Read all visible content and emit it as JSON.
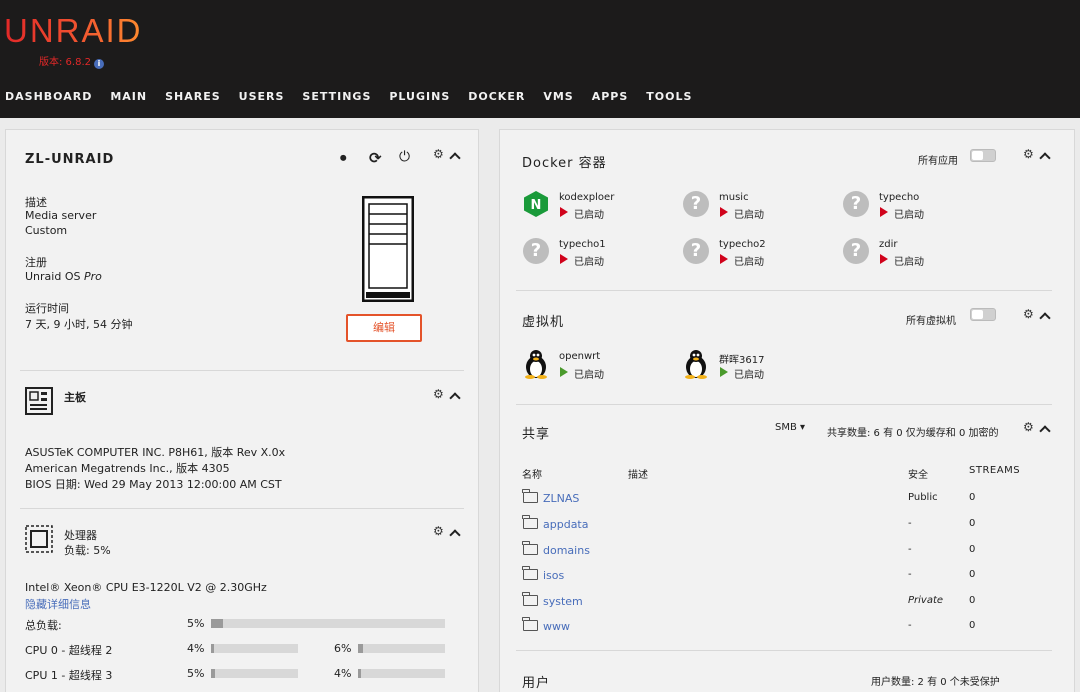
{
  "header": {
    "logo": "UNRAID",
    "version": "版本: 6.8.2",
    "nav": [
      "DASHBOARD",
      "MAIN",
      "SHARES",
      "USERS",
      "SETTINGS",
      "PLUGINS",
      "DOCKER",
      "VMS",
      "APPS",
      "TOOLS"
    ]
  },
  "server": {
    "name": "ZL-UNRAID",
    "desc_label": "描述",
    "desc_line1": "Media server",
    "desc_line2": "Custom",
    "reg_label": "注册",
    "reg_value": "Unraid OS ",
    "reg_tier": "Pro",
    "uptime_label": "运行时间",
    "uptime_value": "7 天, 9 小时, 54 分钟",
    "edit_label": "编辑"
  },
  "motherboard": {
    "title": "主板",
    "line1": "ASUSTeK COMPUTER INC. P8H61, 版本 Rev X.0x",
    "line2": "American Megatrends Inc., 版本 4305",
    "line3": "BIOS 日期: Wed 29 May 2013 12:00:00 AM CST"
  },
  "cpu": {
    "title": "处理器",
    "load_line": "负载: 5%",
    "model": "Intel® Xeon® CPU E3-1220L V2 @ 2.30GHz",
    "hide_link": "隐藏详细信息",
    "total_label": "总负载:",
    "total_value": "5%",
    "total_fraction": 0.05,
    "rows": [
      {
        "label": "CPU 0 - 超线程 2",
        "a": "4%",
        "a_frac": 0.04,
        "b": "6%",
        "b_frac": 0.06
      },
      {
        "label": "CPU 1 - 超线程 3",
        "a": "5%",
        "a_frac": 0.05,
        "b": "4%",
        "b_frac": 0.04
      }
    ]
  },
  "docker": {
    "title": "Docker 容器",
    "all_apps": "所有应用",
    "containers": [
      {
        "name": "kodexploer",
        "status": "已启动",
        "icon": "nginx-icon"
      },
      {
        "name": "music",
        "status": "已启动",
        "icon": "question-icon"
      },
      {
        "name": "typecho",
        "status": "已启动",
        "icon": "question-icon"
      },
      {
        "name": "typecho1",
        "status": "已启动",
        "icon": "question-icon"
      },
      {
        "name": "typecho2",
        "status": "已启动",
        "icon": "question-icon"
      },
      {
        "name": "zdir",
        "status": "已启动",
        "icon": "question-icon"
      }
    ]
  },
  "vms": {
    "title": "虚拟机",
    "all_vms": "所有虚拟机",
    "items": [
      {
        "name": "openwrt",
        "status": "已启动",
        "icon": "tux-icon"
      },
      {
        "name": "群晖3617",
        "status": "已启动",
        "icon": "tux-icon"
      }
    ]
  },
  "shares": {
    "title": "共享",
    "protocol": "SMB",
    "summary": "共享数量: 6 有 0 仅为缓存和 0 加密的",
    "col_name": "名称",
    "col_desc": "描述",
    "col_security": "安全",
    "col_streams": "STREAMS",
    "rows": [
      {
        "name": "ZLNAS",
        "security": "Public",
        "streams": "0"
      },
      {
        "name": "appdata",
        "security": "-",
        "streams": "0"
      },
      {
        "name": "domains",
        "security": "-",
        "streams": "0"
      },
      {
        "name": "isos",
        "security": "-",
        "streams": "0"
      },
      {
        "name": "system",
        "security": "Private",
        "streams": "0"
      },
      {
        "name": "www",
        "security": "-",
        "streams": "0"
      }
    ]
  },
  "users": {
    "title": "用户",
    "summary": "用户数量: 2 有 0 个未受保护"
  },
  "colors": {
    "accent": "#e4532a",
    "running_red": "#d0021b",
    "running_green": "#4a9a2c",
    "link": "#486dba"
  }
}
